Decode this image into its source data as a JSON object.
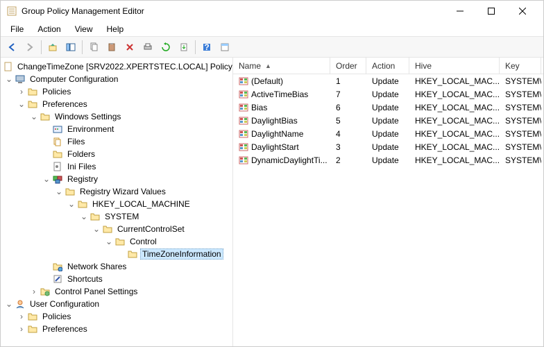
{
  "window": {
    "title": "Group Policy Management Editor"
  },
  "menus": [
    "File",
    "Action",
    "View",
    "Help"
  ],
  "tree": {
    "root": "ChangeTimeZone [SRV2022.XPERTSTEC.LOCAL] Policy",
    "computer_config": "Computer Configuration",
    "policies": "Policies",
    "preferences": "Preferences",
    "windows_settings": "Windows Settings",
    "environment": "Environment",
    "files": "Files",
    "folders": "Folders",
    "ini_files": "Ini Files",
    "registry": "Registry",
    "registry_wizard": "Registry Wizard Values",
    "hklm": "HKEY_LOCAL_MACHINE",
    "system": "SYSTEM",
    "ccs": "CurrentControlSet",
    "control": "Control",
    "tzi": "TimeZoneInformation",
    "network_shares": "Network Shares",
    "shortcuts": "Shortcuts",
    "cp_settings": "Control Panel Settings",
    "user_config": "User Configuration",
    "user_policies": "Policies",
    "user_preferences": "Preferences"
  },
  "columns": {
    "name": "Name",
    "order": "Order",
    "action": "Action",
    "hive": "Hive",
    "key": "Key"
  },
  "rows": [
    {
      "name": "(Default)",
      "order": "1",
      "action": "Update",
      "hive": "HKEY_LOCAL_MAC...",
      "key": "SYSTEM\\C"
    },
    {
      "name": "ActiveTimeBias",
      "order": "7",
      "action": "Update",
      "hive": "HKEY_LOCAL_MAC...",
      "key": "SYSTEM\\C"
    },
    {
      "name": "Bias",
      "order": "6",
      "action": "Update",
      "hive": "HKEY_LOCAL_MAC...",
      "key": "SYSTEM\\C"
    },
    {
      "name": "DaylightBias",
      "order": "5",
      "action": "Update",
      "hive": "HKEY_LOCAL_MAC...",
      "key": "SYSTEM\\C"
    },
    {
      "name": "DaylightName",
      "order": "4",
      "action": "Update",
      "hive": "HKEY_LOCAL_MAC...",
      "key": "SYSTEM\\C"
    },
    {
      "name": "DaylightStart",
      "order": "3",
      "action": "Update",
      "hive": "HKEY_LOCAL_MAC...",
      "key": "SYSTEM\\C"
    },
    {
      "name": "DynamicDaylightTi...",
      "order": "2",
      "action": "Update",
      "hive": "HKEY_LOCAL_MAC...",
      "key": "SYSTEM\\C"
    }
  ]
}
